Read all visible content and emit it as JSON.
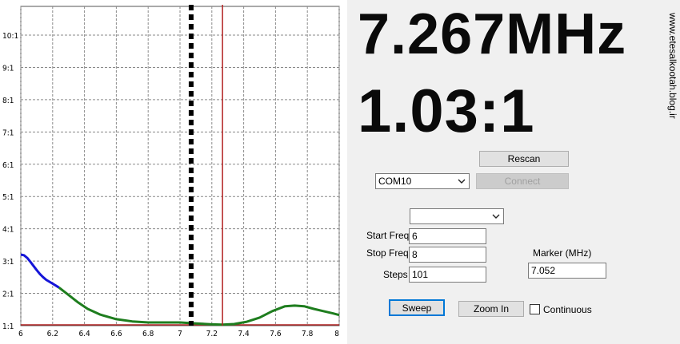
{
  "readout": {
    "frequency": "7.267MHz",
    "swr": "1.03:1"
  },
  "watermark": "www.etesalkootah.blog.ir",
  "controls": {
    "rescan_label": "Rescan",
    "port_value": "COM10",
    "connect_label": "Connect",
    "mode_value": "",
    "start_freq_label": "Start Freq",
    "start_freq_value": "6",
    "stop_freq_label": "Stop Freq",
    "stop_freq_value": "8",
    "steps_label": "Steps",
    "steps_value": "101",
    "marker_label": "Marker (MHz)",
    "marker_value": "7.052",
    "sweep_label": "Sweep",
    "zoom_in_label": "Zoom In",
    "continuous_label": "Continuous",
    "continuous_checked": false
  },
  "chart_data": {
    "type": "line",
    "title": "",
    "xlabel": "",
    "ylabel": "",
    "xlim": [
      6,
      8
    ],
    "ylim": [
      1,
      10
    ],
    "grid": true,
    "x_ticks": [
      "6",
      "6.2",
      "6.4",
      "6.6",
      "6.8",
      "7",
      "7.2",
      "7.4",
      "7.6",
      "7.8",
      "8"
    ],
    "y_ticks": [
      "1:1",
      "2:1",
      "3:1",
      "4:1",
      "5:1",
      "6:1",
      "7:1",
      "8:1",
      "9:1",
      "10:1"
    ],
    "cursor_dashed_x": 7.07,
    "cursor_solid_x": 7.267,
    "colors": {
      "blue_series": "#1515d8",
      "green_series": "#1e7d1e",
      "cursor": "#b22222",
      "dashed": "#000000",
      "grid": "#8a8a8a"
    },
    "series": [
      {
        "color_key": "blue_series",
        "x": [
          6.0,
          6.02,
          6.04,
          6.06,
          6.08,
          6.1,
          6.12,
          6.14,
          6.16,
          6.18,
          6.2,
          6.22,
          6.24
        ],
        "y": [
          3.2,
          3.18,
          3.1,
          2.98,
          2.85,
          2.72,
          2.6,
          2.5,
          2.42,
          2.36,
          2.3,
          2.24,
          2.18
        ]
      },
      {
        "color_key": "green_series",
        "x": [
          6.24,
          6.3,
          6.36,
          6.42,
          6.5,
          6.6,
          6.7,
          6.8,
          6.9,
          7.0,
          7.1,
          7.2,
          7.267,
          7.34,
          7.42,
          7.5,
          7.58,
          7.66,
          7.72,
          7.78,
          7.84,
          7.9,
          7.96,
          8.0
        ],
        "y": [
          2.18,
          1.95,
          1.72,
          1.52,
          1.34,
          1.2,
          1.13,
          1.1,
          1.1,
          1.1,
          1.07,
          1.04,
          1.03,
          1.05,
          1.12,
          1.25,
          1.45,
          1.6,
          1.62,
          1.6,
          1.52,
          1.45,
          1.38,
          1.33
        ]
      }
    ]
  }
}
